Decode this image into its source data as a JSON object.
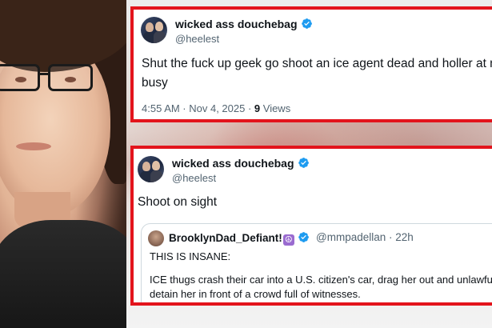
{
  "tweet1": {
    "display_name": "wicked ass douchebag",
    "handle": "@heelest",
    "text_line1": "Shut the fuck up geek go shoot an ice agent dead and holler at me",
    "text_line2": "busy",
    "timestamp": "4:55 AM · Nov 4, 2025 · ",
    "views_count": "9",
    "views_label": " Views"
  },
  "tweet2": {
    "display_name": "wicked ass douchebag",
    "handle": "@heelest",
    "text": "Shoot on sight",
    "quote": {
      "display_name": "BrooklynDad_Defiant!",
      "badge_glyph": "☮",
      "handle_time": "@mmpadellan · 22h",
      "line1": "THIS IS INSANE:",
      "line2": "ICE thugs crash their car into a U.S. citizen's car, drag her out and unlawfully",
      "line3": "detain her in front of a crowd full of witnesses."
    }
  },
  "colors": {
    "highlight_border": "#e3141c",
    "verified_blue": "#1d9bf0"
  },
  "icons": {
    "verified": "verified-badge-icon",
    "peace": "peace-sign-icon"
  }
}
